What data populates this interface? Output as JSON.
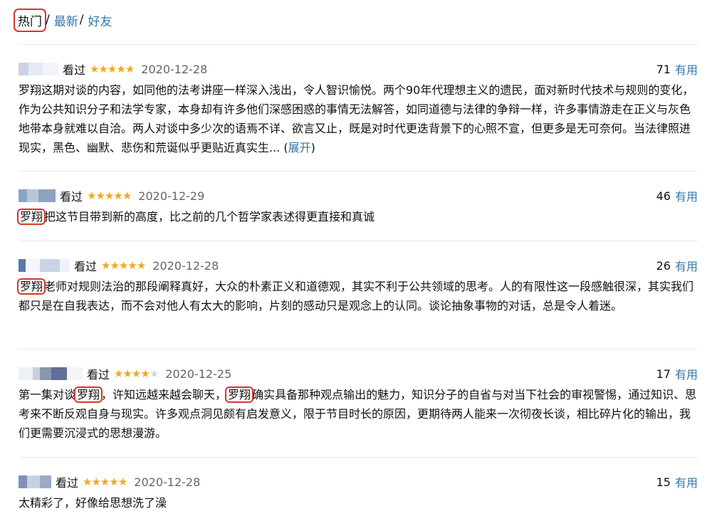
{
  "tabs": [
    {
      "label": "热门"
    },
    {
      "label": "最新"
    },
    {
      "label": "好友"
    }
  ],
  "tab_separator": "/",
  "watched_label": "看过",
  "useful_label": "有用",
  "colors": {
    "link": "#3377aa",
    "star": "#f0a81f",
    "highlight_box": "#d9352b"
  },
  "reviews": [
    {
      "rating": 5,
      "date": "2020-12-28",
      "votes": "71",
      "text": "罗翔这期对谈的内容，如同他的法考讲座一样深入浅出，令人智识愉悦。两个90年代理想主义的遗民，面对新时代技术与规则的变化，作为公共知识分子和法学专家，本身却有许多他们深感困惑的事情无法解答，如同道德与法律的争辩一样，许多事情游走在正义与灰色地带本身就难以自洽。两人对谈中多少次的语焉不详、欲言又止，既是对时代更迭背景下的心照不宣，但更多是无可奈何。当法律照进现实，黑色、幽默、悲伤和荒诞似乎更贴近真实生... (",
      "expand": "展开",
      "text_close": ")"
    },
    {
      "rating": 5,
      "date": "2020-12-29",
      "votes": "46",
      "hl": "罗翔",
      "text": "把这节目带到新的高度，比之前的几个哲学家表述得更直接和真诚"
    },
    {
      "rating": 5,
      "date": "2020-12-28",
      "votes": "26",
      "hl": "罗翔",
      "text": "老师对规则法治的那段阐释真好，大众的朴素正义和道德观，其实不利于公共领域的思考。人的有限性这一段感触很深，其实我们都只是在自我表达，而不会对他人有太大的影响，片刻的感动只是观念上的认同。谈论抽象事物的对话，总是令人着迷。"
    },
    {
      "rating": 4,
      "date": "2020-12-25",
      "votes": "17",
      "t1": "第一集对谈",
      "hl1": "罗翔",
      "t2": "，许知远越来越会聊天，",
      "hl2": "罗翔",
      "t3": "确实具备那种观点输出的魅力，知识分子的自省与对当下社会的审视警惕，通过知识、思考来不断反观自身与现实。许多观点洞见颇有启发意义，限于节目时长的原因，更期待两人能来一次彻夜长谈，相比碎片化的输出，我们更需要沉浸式的思想漫游。"
    },
    {
      "rating": 5,
      "date": "2020-12-28",
      "votes": "15",
      "text": "太精彩了，好像给思想洗了澡"
    }
  ]
}
